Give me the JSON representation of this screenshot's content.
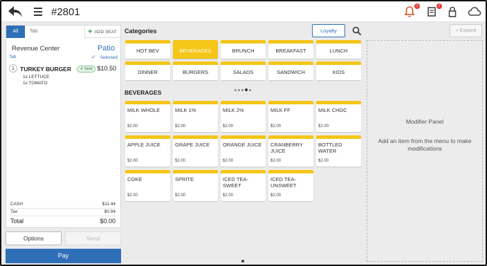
{
  "header": {
    "title": "#2801",
    "icons": [
      "back-icon",
      "menu-icon",
      "bell-icon",
      "receipt-icon",
      "lock-icon",
      "cloud-icon"
    ],
    "notif_badge": "1",
    "receipt_badge": "1"
  },
  "order": {
    "tab_all": "All",
    "tab_placeholder": "Tab",
    "add_seat": "ADD SEAT",
    "revenue_center_label": "Revenue Center",
    "revenue_center_value": "Patio",
    "tab_label": "Tab",
    "selected_label": "Selected",
    "items": [
      {
        "seat": "1",
        "name": "TURKEY BURGER",
        "status": "Sent",
        "price": "$10.50",
        "modifiers": [
          "1x LETTUCE",
          "1x TOMATO"
        ]
      }
    ],
    "totals": {
      "cash_label": "CASH",
      "cash_value": "$11.44",
      "tax_label": "Tax",
      "tax_value": "$0.94",
      "total_label": "Total",
      "total_value": "$0.00"
    },
    "buttons": {
      "options": "Options",
      "send": "Send",
      "pay": "Pay"
    }
  },
  "categories": {
    "header": "Categories",
    "loyalty": "Loyalty",
    "items": [
      "HOT BEV",
      "BEVERAGES",
      "BRUNCH",
      "BREAKFAST",
      "LUNCH",
      "DINNER",
      "BURGERS",
      "SALADS",
      "SANDWICH",
      "KIDS"
    ],
    "active": "BEVERAGES"
  },
  "menu": {
    "header": "BEVERAGES",
    "items": [
      {
        "name": "MILK WHOLE",
        "price": "$2.00"
      },
      {
        "name": "MILK 1%",
        "price": "$2.00"
      },
      {
        "name": "MILK 2%",
        "price": "$2.00"
      },
      {
        "name": "MILK FF",
        "price": "$2.00"
      },
      {
        "name": "MILK CHOC",
        "price": "$2.00"
      },
      {
        "name": "APPLE JUICE",
        "price": "$2.00"
      },
      {
        "name": "GRAPE JUICE",
        "price": "$2.00"
      },
      {
        "name": "ORANGE JUICE",
        "price": "$2.00"
      },
      {
        "name": "CRANBERRY JUICE",
        "price": "$2.00"
      },
      {
        "name": "BOTTLED WATER",
        "price": "$2.00"
      },
      {
        "name": "COKE",
        "price": "$2.00"
      },
      {
        "name": "SPRITE",
        "price": "$2.00"
      },
      {
        "name": "ICED TEA-SWEET",
        "price": "$2.00"
      },
      {
        "name": "ICED TEA-UNSWEET",
        "price": "$2.00"
      }
    ]
  },
  "modifier_panel": {
    "expand": "Expand",
    "title": "Modifier Panel",
    "description": "Add an item from the menu to make modifications"
  },
  "colors": {
    "accent": "#2f6fb8",
    "category_bar": "#f5c518",
    "sent_green": "#2a7a3f",
    "badge_red": "#e53935"
  }
}
